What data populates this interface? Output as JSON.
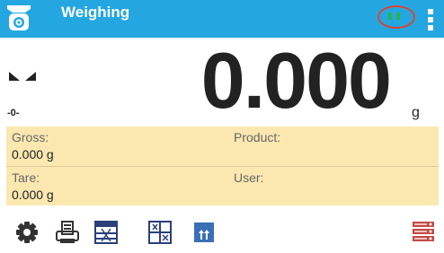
{
  "header": {
    "title": "Weighing",
    "level_indicator": "",
    "home_icon": "home-scale-icon",
    "menu_icon": "kebab-menu-icon",
    "background_color": "#24a7e0"
  },
  "display": {
    "weight": "0.000",
    "unit": "g",
    "zero_indicator": "-0-",
    "stability_icon": "stable-indicator-icon"
  },
  "info_panel": {
    "gross": {
      "label": "Gross:",
      "value": "0.000 g"
    },
    "product": {
      "label": "Product:",
      "value": ""
    },
    "tare": {
      "label": "Tare:",
      "value": "0.000 g"
    },
    "user": {
      "label": "User:",
      "value": ""
    },
    "background_color": "#fbe8b0"
  },
  "toolbar": {
    "buttons": [
      {
        "name": "settings-icon"
      },
      {
        "name": "print-icon"
      },
      {
        "name": "scale-grid-icon"
      },
      {
        "name": "scale-grid-alt-icon"
      },
      {
        "name": "units-icon"
      },
      {
        "name": "database-icon"
      }
    ]
  }
}
